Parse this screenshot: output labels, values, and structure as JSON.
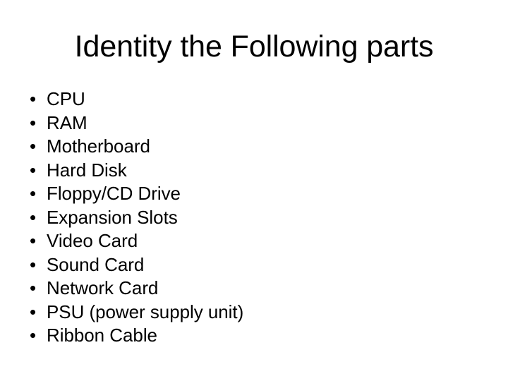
{
  "slide": {
    "title": "Identity the Following parts",
    "background_color": "#ffffff",
    "text_color": "#000000",
    "bullet_glyph": "•",
    "items": [
      {
        "label": "CPU"
      },
      {
        "label": "RAM"
      },
      {
        "label": "Motherboard"
      },
      {
        "label": "Hard Disk"
      },
      {
        "label": "Floppy/CD Drive"
      },
      {
        "label": "Expansion Slots"
      },
      {
        "label": "Video Card"
      },
      {
        "label": "Sound Card"
      },
      {
        "label": "Network Card"
      },
      {
        "label": "PSU (power supply unit)"
      },
      {
        "label": "Ribbon Cable"
      }
    ]
  }
}
